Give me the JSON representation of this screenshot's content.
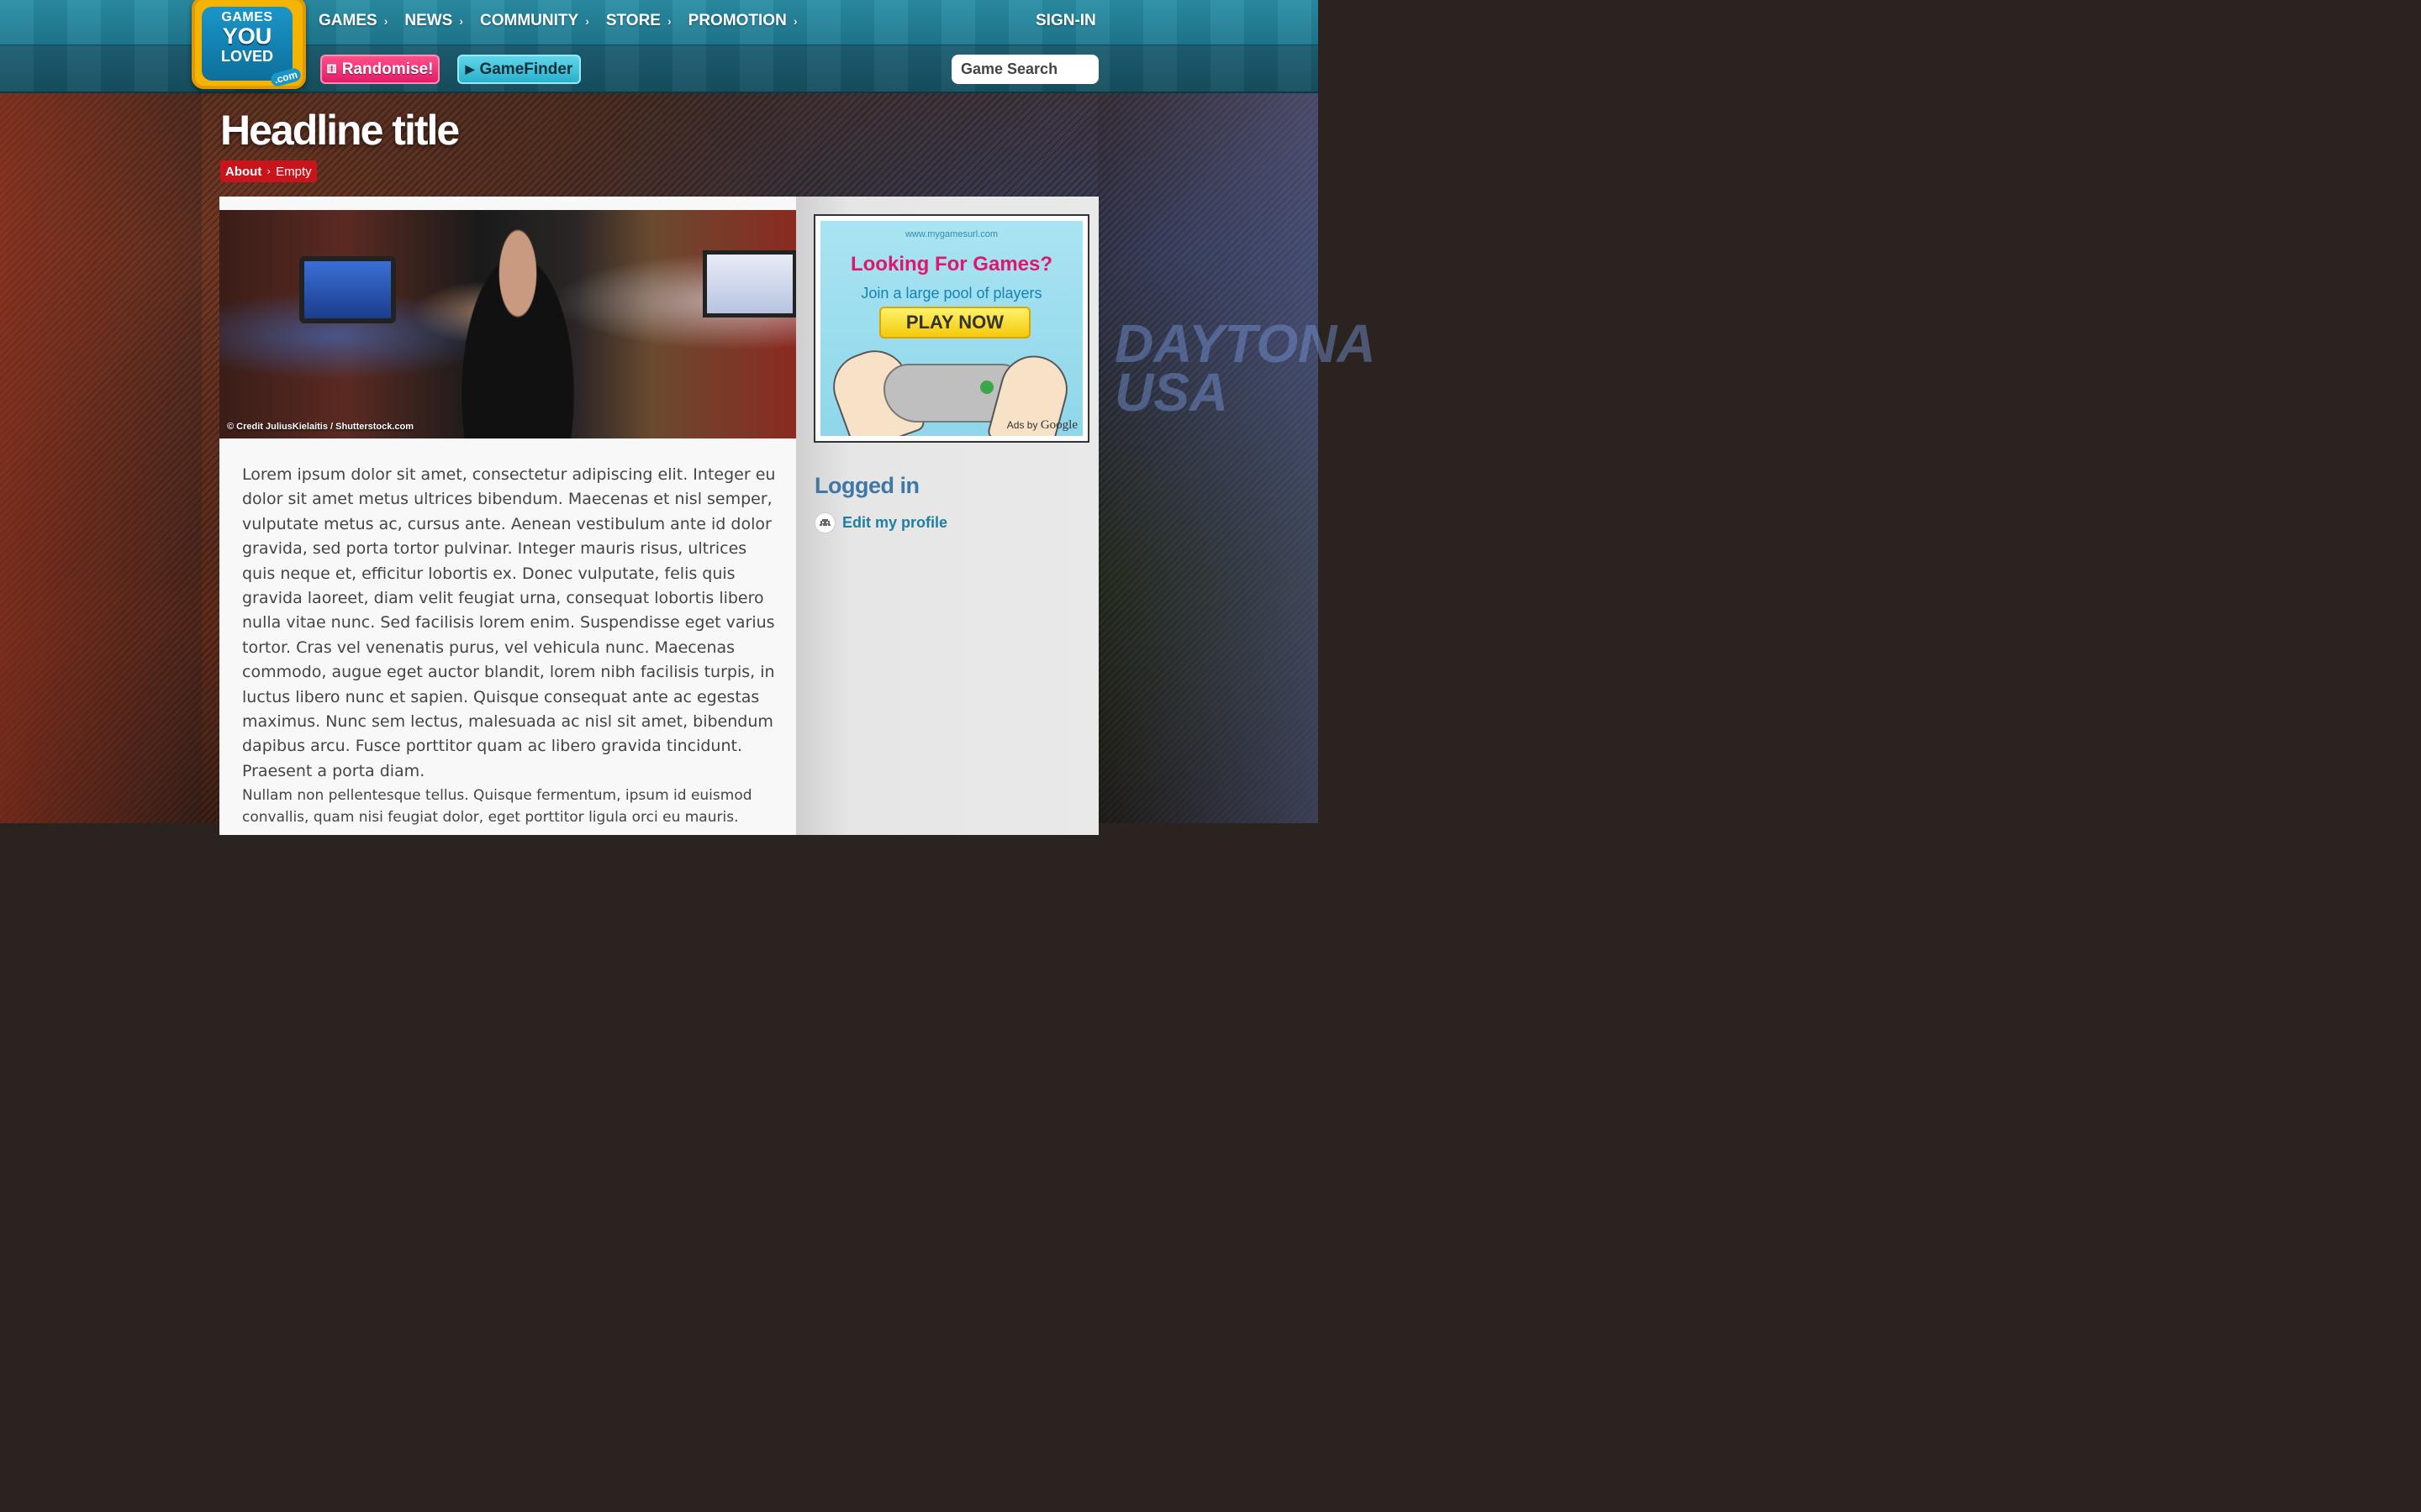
{
  "header": {
    "logo": {
      "line1": "GAMES",
      "line2": "YOU",
      "line3": "LOVED",
      "suffix": ".com"
    },
    "nav": [
      {
        "label": "GAMES"
      },
      {
        "label": "NEWS"
      },
      {
        "label": "COMMUNITY"
      },
      {
        "label": "STORE"
      },
      {
        "label": "PROMOTION"
      }
    ],
    "signin_label": "SIGN-IN",
    "randomise_label": "Randomise!",
    "gamefinder_label": "GameFinder",
    "search": {
      "placeholder": "Game Search"
    }
  },
  "page": {
    "title": "Headline title",
    "breadcrumb": {
      "parent": "About",
      "current": "Empty"
    }
  },
  "hero": {
    "credit": "© Credit JuliusKielaitis / Shutterstock.com"
  },
  "article": {
    "paragraph1": "Lorem ipsum dolor sit amet, consectetur adipiscing elit. Integer eu dolor sit amet metus ultrices bibendum. Maecenas et nisl semper, vulputate metus ac, cursus ante. Aenean vestibulum ante id dolor gravida, sed porta tortor pulvinar. Integer mauris risus, ultrices quis neque et, efficitur lobortis ex. Donec vulputate, felis quis gravida laoreet, diam velit feugiat urna, consequat lobortis libero nulla vitae nunc. Sed facilisis lorem enim. Suspendisse eget varius tortor. Cras vel venenatis purus, vel vehicula nunc. Maecenas commodo, augue eget auctor blandit, lorem nibh facilisis turpis, in luctus libero nunc et sapien. Quisque consequat ante ac egestas maximus. Nunc sem lectus, malesuada ac nisl sit amet, bibendum dapibus arcu. Fusce porttitor quam ac libero gravida tincidunt. Praesent a porta diam.",
    "paragraph2": "Nullam non pellentesque tellus. Quisque fermentum, ipsum id euismod convallis, quam nisi feugiat dolor, eget porttitor ligula orci eu mauris."
  },
  "sidebar": {
    "ad": {
      "url": "www.mygamesurl.com",
      "title": "Looking For Games?",
      "subtitle": "Join a large pool of players",
      "cta": "PLAY NOW",
      "ads_by": "Ads by",
      "ads_brand": "Google"
    },
    "logged_in_title": "Logged in",
    "edit_profile_label": "Edit my profile"
  },
  "background": {
    "cabinet_text": "DAYTONA USA"
  },
  "colors": {
    "header_teal": "#2a8fa5",
    "randomise_pink": "#e21c68",
    "gamefinder_cyan": "#2bb0cc",
    "breadcrumb_red": "#c8141a",
    "sidebar_title_blue": "#3f77a6",
    "link_blue": "#1f7fa3"
  }
}
